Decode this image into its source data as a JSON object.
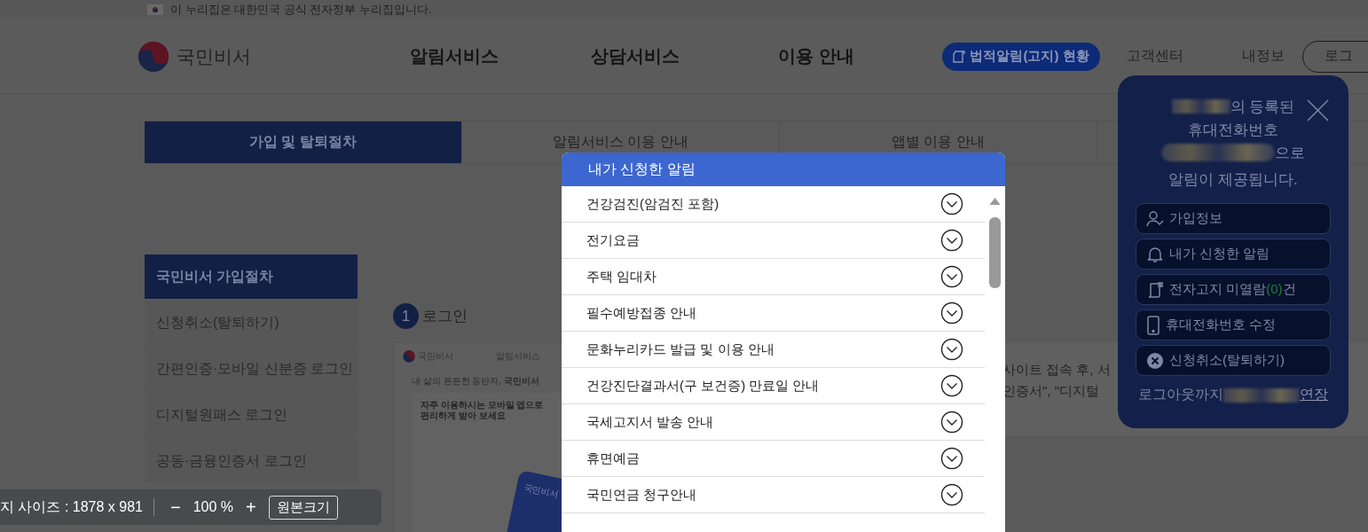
{
  "gov_banner": {
    "text": "이 누리집은 대한민국 공식 전자정부 누리집입니다."
  },
  "header": {
    "logo": "국민비서",
    "nav": [
      "알림서비스",
      "상담서비스",
      "이용 안내"
    ],
    "legal_button": "법적알림(고지) 현황",
    "links": [
      "고객센터",
      "내정보"
    ],
    "login_button": "로그"
  },
  "tabs": [
    {
      "label": "가입 및 탈퇴절차",
      "selected": true
    },
    {
      "label": "알림서비스 이용 안내",
      "selected": false
    },
    {
      "label": "앱별 이용 안내",
      "selected": false
    }
  ],
  "sidebar": {
    "items": [
      {
        "label": "국민비서 가입절차",
        "selected": true
      },
      {
        "label": "신청취소(탈퇴하기)",
        "selected": false
      },
      {
        "label": "간편인증·모바일 신분증 로그인",
        "selected": false
      },
      {
        "label": "디지털원패스 로그인",
        "selected": false
      },
      {
        "label": "공동·금융인증서 로그인",
        "selected": false
      }
    ]
  },
  "step": {
    "number": "1",
    "label": "로그인"
  },
  "preview": {
    "logo": "국민비서",
    "nav": "알림서비스",
    "tagline": "내 삶의 든든한 동반자, **국민비서**",
    "headline": [
      "자주 이용하시는 모바일 앱으로",
      "편리하게 받아 보세요"
    ],
    "phone_label": "국민비서"
  },
  "body_text": [
    "사이트 접속 후, 서",
    "인증서\", \"디지털"
  ],
  "notification_popup": {
    "title": "내가 신청한 알림",
    "items": [
      "건강검진(암검진 포함)",
      "전기요금",
      "주택 임대차",
      "필수예방접종 안내",
      "문화누리카드 발급 및 이용 안내",
      "건강진단결과서(구 보건증) 만료일 안내",
      "국세고지서 발송 안내",
      "휴면예금",
      "국민연금 청구안내"
    ]
  },
  "account_popup": {
    "line_1": "의 등록된",
    "line_2": "휴대전화번호",
    "line_3": "으로",
    "line_4": "알림이 제공됩니다.",
    "menu": [
      {
        "kind": "person",
        "label": "가입정보"
      },
      {
        "kind": "bell",
        "label": "내가 신청한 알림"
      },
      {
        "kind": "document",
        "label": "전자고지 미열람",
        "count": "(0)",
        "suffix": "건"
      },
      {
        "kind": "phone",
        "label": "휴대전화번호 수정"
      },
      {
        "kind": "cancel",
        "label": "신청취소(탈퇴하기)"
      }
    ],
    "logout_text": "로그아웃까지",
    "extend_link": "연장"
  },
  "zoom_bar": {
    "size_label": "지 사이즈 : 1878 x 981",
    "minus": "−",
    "zoom": "100 %",
    "plus": "+",
    "reset_button": "원본크기"
  }
}
